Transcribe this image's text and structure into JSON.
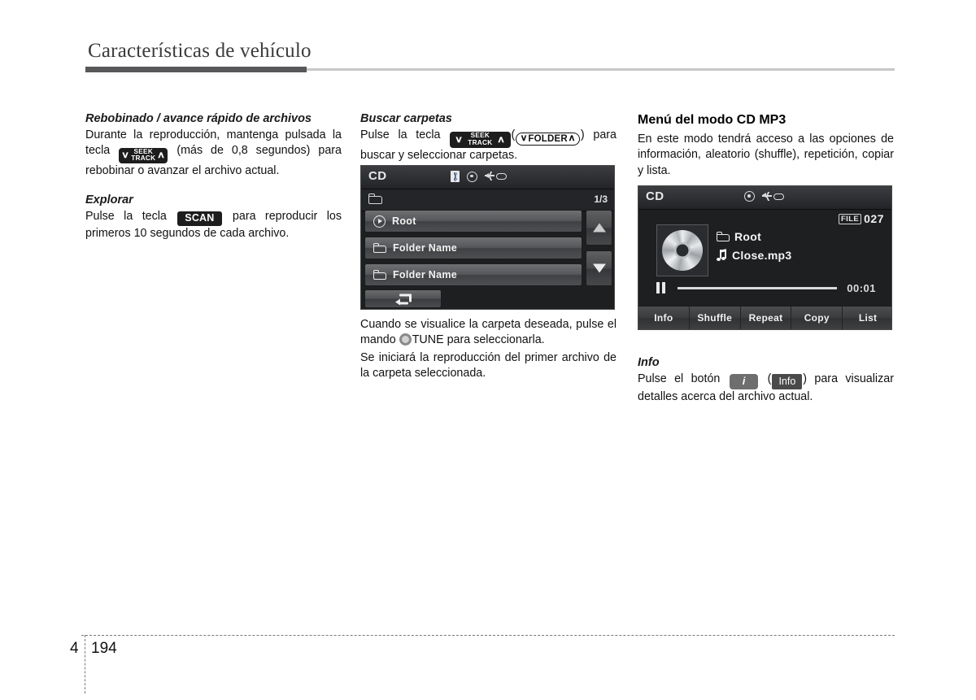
{
  "header": {
    "title": "Características de vehículo"
  },
  "footer": {
    "chapter": "4",
    "page": "194"
  },
  "columns": {
    "left": {
      "section1": {
        "heading": "Rebobinado / avance rápido de archivos",
        "text_before_key": "Durante la reproducción, mantenga pulsada la tecla",
        "key_seek": {
          "top": "SEEK",
          "bottom": "TRACK",
          "chev_down": "∨",
          "chev_up": "∧"
        },
        "text_after_key": "(más de 0,8 segundos) para rebobinar o avanzar el archivo actual."
      },
      "section2": {
        "heading": "Explorar",
        "text_before_key": "Pulse la tecla",
        "key_scan": "SCAN",
        "text_after_key": "para reproducir los primeros 10 segundos de cada archivo."
      }
    },
    "middle": {
      "heading": "Buscar carpetas",
      "text_before_key": "Pulse la tecla",
      "key_seek": {
        "top": "SEEK",
        "bottom": "TRACK",
        "chev_down": "∨",
        "chev_up": "∧"
      },
      "paren_open": "(",
      "key_folder": {
        "label": "FOLDER",
        "chev_down": "∨",
        "chev_up": "∧"
      },
      "paren_close": ")",
      "text_after_key": "para buscar y seleccionar carpetas.",
      "caption_1_before": "Cuando se visualice la carpeta deseada, pulse el mando",
      "knob_label": "TUNE",
      "caption_1_after": "para seleccionarla.",
      "caption_2": "Se iniciará la reproducción del primer archivo de la carpeta seleccionada."
    },
    "right": {
      "heading": "Menú del modo CD MP3",
      "intro": "En este modo tendrá acceso a las opciones de información, aleatorio (shuffle), repetición, copiar y lista.",
      "info_heading": "Info",
      "info_text_before": "Pulse el botón",
      "key_i": "i",
      "paren_open": "(",
      "key_info": "Info",
      "paren_close": ")",
      "info_text_after": "para visualizar detalles acerca del archivo actual."
    }
  },
  "folder_screen": {
    "title": "CD",
    "icons": [
      "bluetooth-icon",
      "disc-icon",
      "usb-icon"
    ],
    "page_indicator": "1/3",
    "rows": [
      {
        "icon": "play-icon",
        "label": "Root"
      },
      {
        "icon": "folder-icon",
        "label": "Folder Name"
      },
      {
        "icon": "folder-icon",
        "label": "Folder Name"
      }
    ],
    "scroll_up": "▲",
    "scroll_down": "▼",
    "back_button": "back-arrow-icon"
  },
  "player_screen": {
    "title": "CD",
    "icons": [
      "disc-icon",
      "usb-icon"
    ],
    "file_badge": "FILE",
    "file_number": "027",
    "album_art": "cd-disc-image",
    "folder_name": "Root",
    "track_name": "Close.mp3",
    "transport_state": "pause-icon",
    "elapsed_time": "00:01",
    "buttons": [
      "Info",
      "Shuffle",
      "Repeat",
      "Copy",
      "List"
    ]
  },
  "colors": {
    "header_rule_dark": "#58585a",
    "header_rule_light": "#c8c8ca",
    "screen_bg": "#1e1f21",
    "key_dark": "#1d1d1d",
    "key_gray": "#6e6e6e"
  }
}
